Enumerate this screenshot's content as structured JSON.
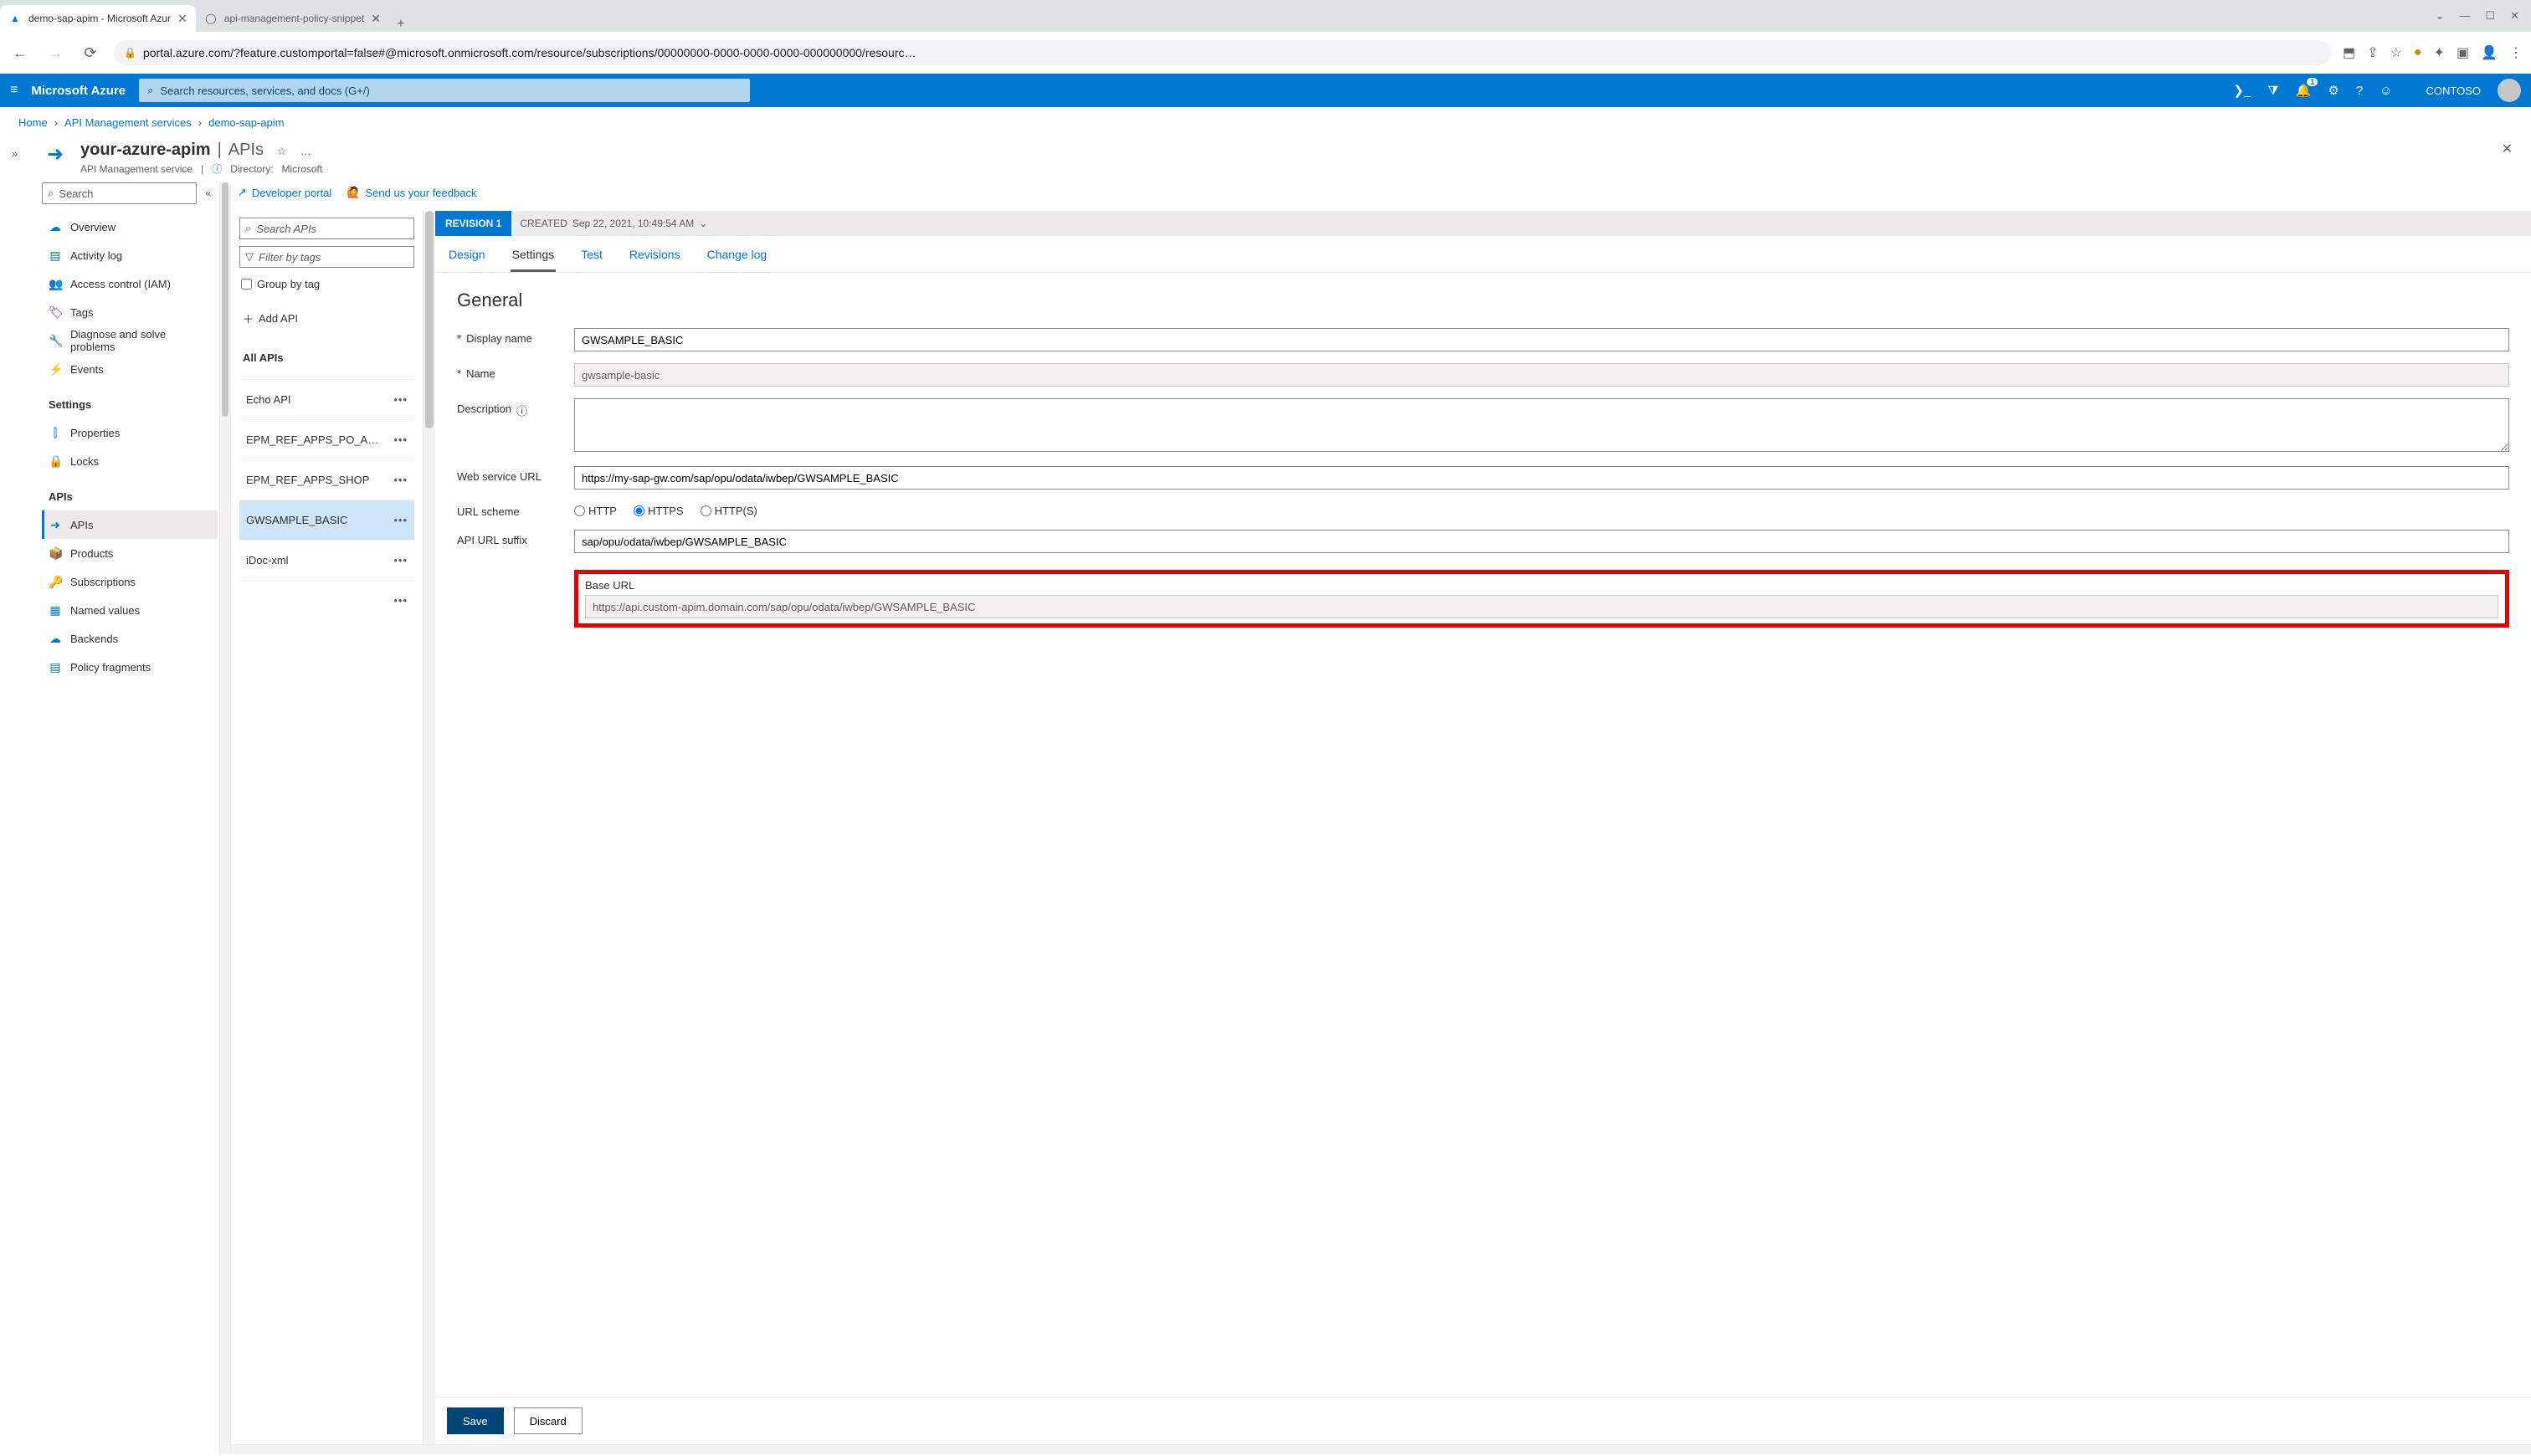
{
  "browser": {
    "tabs": [
      {
        "title": "demo-sap-apim - Microsoft Azur",
        "favicon": "▲"
      },
      {
        "title": "api-management-policy-snippet",
        "favicon": "◌"
      }
    ],
    "url": "portal.azure.com/?feature.customportal=false#@microsoft.onmicrosoft.com/resource/subscriptions/00000000-0000-0000-0000-000000000/resourc…"
  },
  "azure": {
    "brand": "Microsoft Azure",
    "search_placeholder": "Search resources, services, and docs (G+/)",
    "tenant": "CONTOSO"
  },
  "breadcrumb": {
    "home": "Home",
    "svc": "API Management services",
    "res": "demo-sap-apim"
  },
  "resource": {
    "name": "your-azure-apim",
    "section": "APIs",
    "type": "API Management service",
    "directory_label": "Directory:",
    "directory_value": "Microsoft"
  },
  "menu": {
    "search_placeholder": "Search",
    "items_top": [
      {
        "icon": "☁",
        "label": "Overview",
        "color": "#0078d4"
      },
      {
        "icon": "▤",
        "label": "Activity log",
        "color": "#0078d4"
      },
      {
        "icon": "👥",
        "label": "Access control (IAM)",
        "color": "#0078d4"
      },
      {
        "icon": "🏷",
        "label": "Tags",
        "color": "#7719aa"
      },
      {
        "icon": "🔧",
        "label": "Diagnose and solve problems",
        "color": "#323130"
      },
      {
        "icon": "⚡",
        "label": "Events",
        "color": "#ffb900"
      }
    ],
    "heading_settings": "Settings",
    "items_settings": [
      {
        "icon": "⫿",
        "label": "Properties",
        "color": "#0078d4"
      },
      {
        "icon": "🔒",
        "label": "Locks",
        "color": "#0078d4"
      }
    ],
    "heading_apis": "APIs",
    "items_apis": [
      {
        "icon": "➜",
        "label": "APIs",
        "color": "#0078d4",
        "active": true
      },
      {
        "icon": "📦",
        "label": "Products",
        "color": "#0078d4"
      },
      {
        "icon": "🔑",
        "label": "Subscriptions",
        "color": "#ffb900"
      },
      {
        "icon": "▦",
        "label": "Named values",
        "color": "#0078d4"
      },
      {
        "icon": "☁",
        "label": "Backends",
        "color": "#0078d4"
      },
      {
        "icon": "▤",
        "label": "Policy fragments",
        "color": "#0078d4"
      }
    ]
  },
  "toolbar": {
    "dev_portal": "Developer portal",
    "feedback": "Send us your feedback"
  },
  "api_list": {
    "search_placeholder": "Search APIs",
    "filter_placeholder": "Filter by tags",
    "group_by_tag": "Group by tag",
    "add_api": "Add API",
    "all_apis": "All APIs",
    "items": [
      {
        "label": "Echo API"
      },
      {
        "label": "EPM_REF_APPS_PO_A…"
      },
      {
        "label": "EPM_REF_APPS_SHOP"
      },
      {
        "label": "GWSAMPLE_BASIC",
        "selected": true
      },
      {
        "label": "iDoc-xml"
      },
      {
        "label": ""
      }
    ]
  },
  "detail": {
    "revision_label": "REVISION 1",
    "created_label": "CREATED",
    "created_value": "Sep 22, 2021, 10:49:54 AM",
    "tabs": [
      "Design",
      "Settings",
      "Test",
      "Revisions",
      "Change log"
    ],
    "active_tab": "Settings",
    "section_general": "General",
    "labels": {
      "display_name": "Display name",
      "name": "Name",
      "description": "Description",
      "web_service_url": "Web service URL",
      "url_scheme": "URL scheme",
      "api_url_suffix": "API URL suffix",
      "base_url": "Base URL"
    },
    "values": {
      "display_name": "GWSAMPLE_BASIC",
      "name": "gwsample-basic",
      "description": "",
      "web_service_url": "https://my-sap-gw.com/sap/opu/odata/iwbep/GWSAMPLE_BASIC",
      "api_url_suffix": "sap/opu/odata/iwbep/GWSAMPLE_BASIC",
      "base_url": "https://api.custom-apim.domain.com/sap/opu/odata/iwbep/GWSAMPLE_BASIC"
    },
    "url_scheme_options": {
      "http": "HTTP",
      "https": "HTTPS",
      "both": "HTTP(S)"
    },
    "url_scheme_selected": "https",
    "buttons": {
      "save": "Save",
      "discard": "Discard"
    }
  }
}
